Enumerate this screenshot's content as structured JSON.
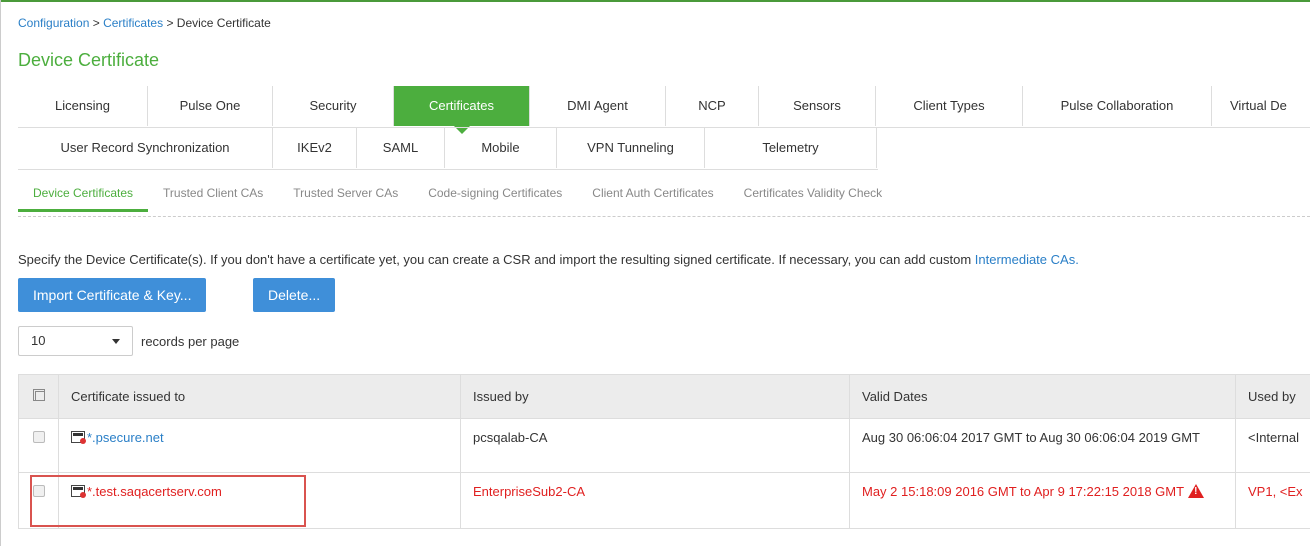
{
  "breadcrumb": {
    "configuration": "Configuration",
    "sep1": " > ",
    "certificates": "Certificates",
    "sep2": " > ",
    "current": "Device Certificate"
  },
  "page_title": "Device Certificate",
  "tabs_row1": [
    {
      "label": "Licensing",
      "active": false
    },
    {
      "label": "Pulse One",
      "active": false
    },
    {
      "label": "Security",
      "active": false
    },
    {
      "label": "Certificates",
      "active": true
    },
    {
      "label": "DMI Agent",
      "active": false
    },
    {
      "label": "NCP",
      "active": false
    },
    {
      "label": "Sensors",
      "active": false
    },
    {
      "label": "Client Types",
      "active": false
    },
    {
      "label": "Pulse Collaboration",
      "active": false
    },
    {
      "label": "Virtual De",
      "active": false
    }
  ],
  "tabs_row2": [
    {
      "label": "User Record Synchronization"
    },
    {
      "label": "IKEv2"
    },
    {
      "label": "SAML"
    },
    {
      "label": "Mobile"
    },
    {
      "label": "VPN Tunneling"
    },
    {
      "label": "Telemetry"
    }
  ],
  "subtabs": [
    {
      "label": "Device Certificates",
      "active": true
    },
    {
      "label": "Trusted Client CAs",
      "active": false
    },
    {
      "label": "Trusted Server CAs",
      "active": false
    },
    {
      "label": "Code-signing Certificates",
      "active": false
    },
    {
      "label": "Client Auth Certificates",
      "active": false
    },
    {
      "label": "Certificates Validity Check",
      "active": false
    }
  ],
  "description": {
    "text": "Specify the Device Certificate(s). If you don't have a certificate yet, you can create a CSR and import the resulting signed certificate. If necessary, you can add custom ",
    "link": "Intermediate CAs."
  },
  "buttons": {
    "import": "Import Certificate & Key...",
    "delete": "Delete..."
  },
  "pager": {
    "value": "10",
    "label": "records per page"
  },
  "table": {
    "headers": [
      "Certificate issued to",
      "Issued by",
      "Valid Dates",
      "Used by"
    ],
    "rows": [
      {
        "issued_to": "*.psecure.net",
        "issued_by": "pcsqalab-CA",
        "valid_dates": "Aug 30 06:06:04 2017 GMT to Aug 30 06:06:04 2019 GMT",
        "used_by": "<Internal",
        "expired": false
      },
      {
        "issued_to": "*.test.saqacertserv.com",
        "issued_by": "EnterpriseSub2-CA",
        "valid_dates": "May 2 15:18:09 2016 GMT to Apr 9 17:22:15 2018 GMT",
        "used_by": "VP1, <Ex",
        "expired": true
      }
    ]
  },
  "colors": {
    "accent_green": "#4cae3e",
    "link_blue": "#2a7fc7",
    "button_blue": "#3f8fd9",
    "error_red": "#e02020"
  }
}
